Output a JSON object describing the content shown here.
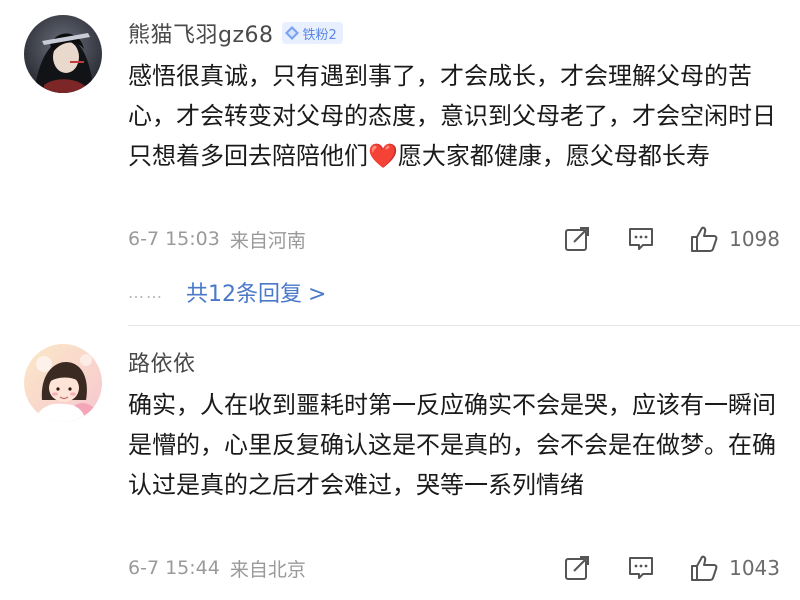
{
  "comments": [
    {
      "username": "熊猫飞羽gz68",
      "badge": "铁粉2",
      "text": "感悟很真诚，只有遇到事了，才会成长，才会理解父母的苦心，才会转变对父母的态度，意识到父母老了，才会空闲时日只想着多回去陪陪他们❤️愿大家都健康，愿父母都长寿",
      "time": "6-7 15:03",
      "location": "来自河南",
      "likes": "1098",
      "dots": "……",
      "replies": "共12条回复",
      "replies_chevron": ">"
    },
    {
      "username": "路依依",
      "text": "确实，人在收到噩耗时第一反应确实不会是哭，应该有一瞬间是懵的，心里反复确认这是不是真的，会不会是在做梦。在确认过是真的之后才会难过，哭等一系列情绪",
      "time": "6-7 15:44",
      "location": "来自北京",
      "likes": "1043"
    }
  ],
  "icons": {
    "share": "share-icon",
    "reply": "comment-icon",
    "like": "thumbs-up-icon",
    "badge": "diamond-icon"
  },
  "colors": {
    "link": "#4a79c9",
    "badge_bg": "#e8f0ff",
    "badge_text": "#5c87e6",
    "meta": "#9a9a9a"
  }
}
